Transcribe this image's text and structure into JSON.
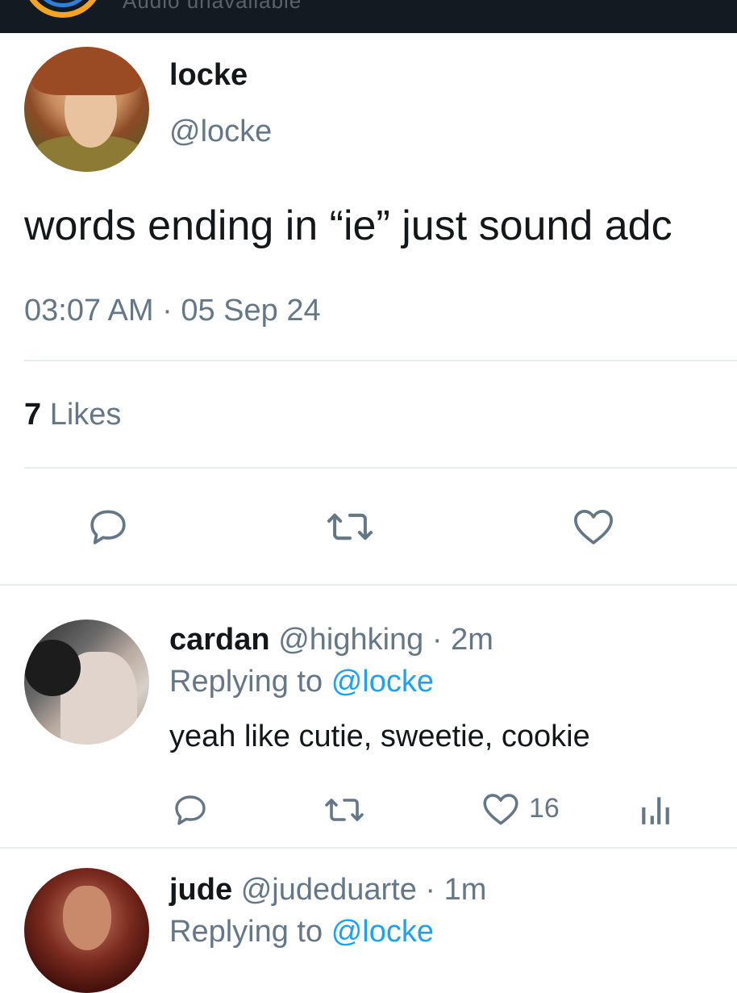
{
  "topbar": {
    "faded_text": "Audio unavailable"
  },
  "tweet": {
    "author_name": "locke",
    "author_handle": "@locke",
    "text": "words ending in “ie” just sound adc",
    "timestamp": "03:07 AM · 05 Sep 24",
    "likes_count": "7",
    "likes_label": "Likes"
  },
  "replies": [
    {
      "name": "cardan",
      "meta": "@highking · 2m",
      "replying_prefix": "Replying to",
      "replying_mention": "@locke",
      "text": "yeah like cutie, sweetie, cookie",
      "like_count": "16"
    },
    {
      "name": "jude",
      "meta": "@judeduarte · 1m",
      "replying_prefix": "Replying to",
      "replying_mention": "@locke"
    }
  ],
  "colors": {
    "topbar_bg": "#141a22",
    "text_primary": "#14171a",
    "text_secondary": "#657786",
    "link": "#1da1f2",
    "divider": "#e6ecf0"
  },
  "icons": [
    "reply-icon",
    "retweet-icon",
    "like-icon",
    "analytics-icon"
  ]
}
